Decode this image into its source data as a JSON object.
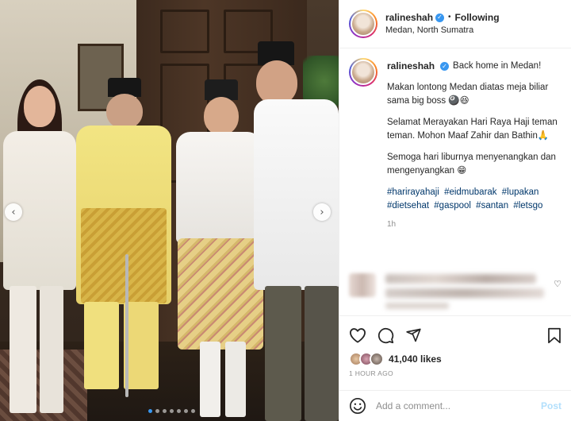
{
  "post": {
    "username": "ralineshah",
    "verified_glyph": "✓",
    "separator": "•",
    "follow_status": "Following",
    "location": "Medan, North Sumatra"
  },
  "caption": {
    "first_line": "Back home in Medan!",
    "paragraph1": "Makan lontong Medan diatas meja biliar sama big boss 🎱😆",
    "paragraph2": "Selamat Merayakan Hari Raya Haji teman teman. Mohon Maaf Zahir dan Bathin🙏",
    "paragraph3": "Semoga hari liburnya menyenangkan dan mengenyangkan 😁",
    "hashtags": [
      "#harirayahaji",
      "#eidmubarak",
      "#lupakan",
      "#dietsehat",
      "#gaspool",
      "#santan",
      "#letsgo"
    ],
    "time_ago": "1h"
  },
  "carousel": {
    "prev_glyph": "‹",
    "next_glyph": "›",
    "dot_count": 7,
    "active_index": 0
  },
  "comment_preview": {
    "heart_glyph": "♡",
    "blurred": true
  },
  "engagement": {
    "likes": "41,040 likes",
    "posted": "1 HOUR AGO"
  },
  "comment_box": {
    "placeholder": "Add a comment...",
    "post_label": "Post"
  },
  "icons": {
    "like": "heart-icon",
    "comment": "comment-icon",
    "share": "share-icon",
    "save": "bookmark-icon",
    "emoji": "emoji-icon"
  },
  "colors": {
    "link": "#00376b",
    "verified": "#3897f0",
    "muted": "#8e8e8e",
    "post_disabled": "#b2dffc",
    "divider": "#efefef"
  }
}
